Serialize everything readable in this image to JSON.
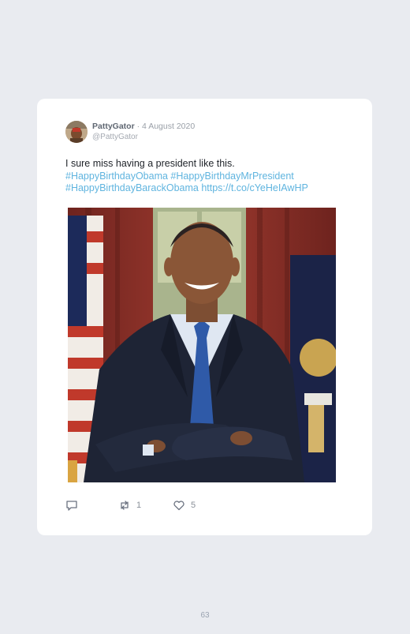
{
  "tweet": {
    "display_name": "PattyGator",
    "separator": " · ",
    "date": "4 August 2020",
    "handle": "@PattyGator",
    "text_line1": "I sure miss having a president like this.",
    "tag1": "#HappyBirthdayObama",
    "tag2": "#HappyBirthdayMrPresident",
    "tag3": "#HappyBirthdayBarackObama",
    "link": "https://t.co/cYeHeIAwHP",
    "reply_count": "",
    "retweet_count": "1",
    "like_count": "5"
  },
  "icons": {
    "reply": "reply-icon",
    "retweet": "retweet-icon",
    "like": "heart-icon"
  },
  "colors": {
    "hashtag": "#5fb4df",
    "card": "#ffffff",
    "background": "#e9ebf0"
  },
  "page": {
    "number": "63"
  }
}
